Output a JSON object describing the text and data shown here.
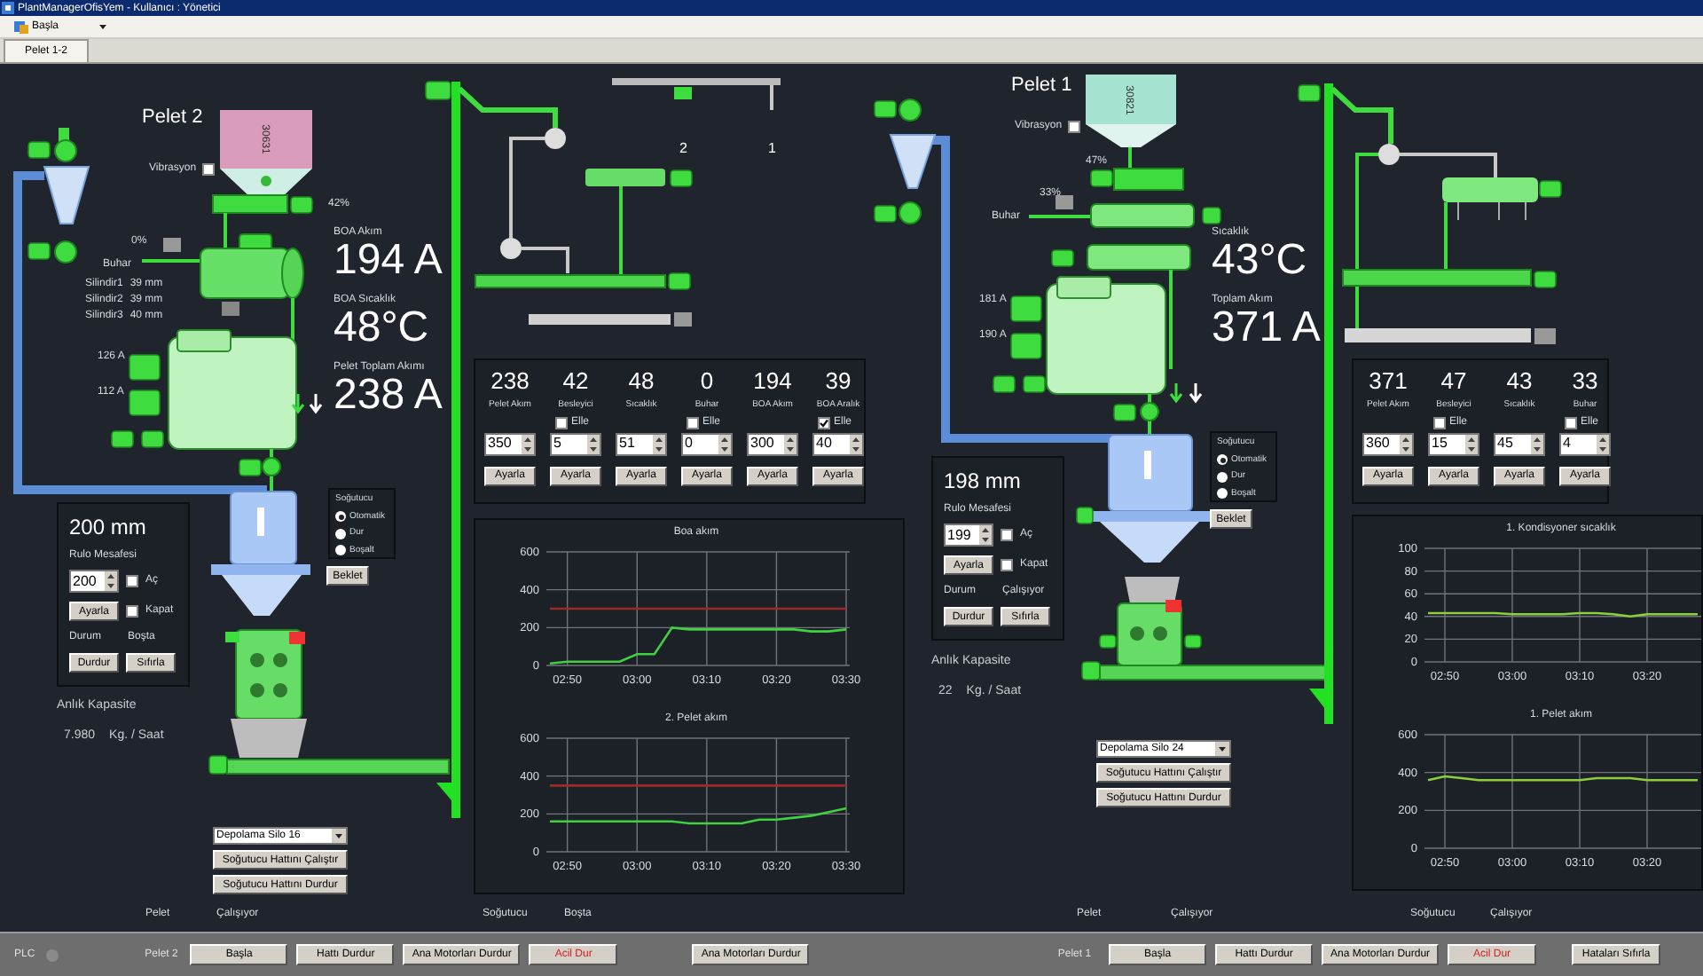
{
  "window": {
    "title": "PlantManagerOfisYem - Kullanıcı : Yönetici"
  },
  "menu": [
    {
      "label": "Başla"
    }
  ],
  "tabs": [
    {
      "label": "Pelet 1-2",
      "selected": true
    }
  ],
  "transfer_gates": [
    "2",
    "1"
  ],
  "lines": [
    {
      "title": "Pelet 2",
      "color": "#d99cbb",
      "silo_code": "30631",
      "vibration": {
        "label": "Vibrasyon",
        "checked": false
      },
      "feeder_percent": "42%",
      "steam": {
        "label": "Buhar",
        "percent": "0%"
      },
      "rollers": [
        {
          "label": "Silindir1",
          "value": "39 mm"
        },
        {
          "label": "Silindir2",
          "value": "39 mm"
        },
        {
          "label": "Silindir3",
          "value": "40 mm"
        }
      ],
      "readings": [
        {
          "label": "BOA Akım",
          "value": "194 A"
        },
        {
          "label": "BOA Sıcaklık",
          "value": "48°C"
        },
        {
          "label": "Pelet Toplam Akımı",
          "value": "238 A"
        }
      ],
      "motor_currents": [
        "126 A",
        "112 A"
      ],
      "setpoints": [
        {
          "value": "238",
          "label": "Pelet Akım",
          "input": "350",
          "button": "Ayarla"
        },
        {
          "value": "42",
          "label": "Besleyici",
          "manual": {
            "label": "Elle",
            "checked": false
          },
          "input": "5",
          "button": "Ayarla"
        },
        {
          "value": "48",
          "label": "Sıcaklık",
          "input": "51",
          "button": "Ayarla"
        },
        {
          "value": "0",
          "label": "Buhar",
          "manual": {
            "label": "Elle",
            "checked": false
          },
          "input": "0",
          "button": "Ayarla"
        },
        {
          "value": "194",
          "label": "BOA Akım",
          "input": "300",
          "button": "Ayarla"
        },
        {
          "value": "39",
          "label": "BOA Aralık",
          "manual": {
            "label": "Elle",
            "checked": true
          },
          "input": "40",
          "button": "Ayarla"
        }
      ],
      "roll_gap": {
        "value": "200 mm",
        "label": "Rulo Mesafesi",
        "input": "200",
        "open": {
          "label": "Aç",
          "checked": false
        },
        "close": {
          "label": "Kapat",
          "checked": false
        },
        "button": "Ayarla",
        "status_label": "Durum",
        "status": "Boşta",
        "buttons": [
          "Durdur",
          "Sıfırla"
        ]
      },
      "capacity": {
        "label": "Anlık Kapasite",
        "value": "7.980",
        "unit": "Kg. / Saat"
      },
      "cooler": {
        "title": "Soğutucu",
        "options": [
          {
            "label": "Otomatik",
            "selected": true
          },
          {
            "label": "Dur",
            "selected": false
          },
          {
            "label": "Boşalt",
            "selected": false
          }
        ],
        "button": "Beklet"
      },
      "silo": {
        "value": "Depolama Silo 16",
        "buttons": [
          "Soğutucu Hattını Çalıştır",
          "Soğutucu Hattını Durdur"
        ]
      },
      "charts": [
        {
          "chart_data": {
            "type": "line",
            "grid": true,
            "title": "Boa akım",
            "categories": [
              null,
              "02:50",
              null,
              null,
              null,
              "03:00",
              null,
              null,
              null,
              "03:10",
              null,
              null,
              null,
              "03:20",
              null,
              null,
              null,
              "03:30"
            ],
            "series": [
              {
                "color": "#3fd13f",
                "values": [
                  10,
                  20,
                  20,
                  20,
                  20,
                  60,
                  60,
                  200,
                  190,
                  190,
                  190,
                  190,
                  190,
                  190,
                  190,
                  180,
                  180,
                  190
                ]
              },
              {
                "color": "#a02828",
                "values": [
                  300,
                  300,
                  300,
                  300,
                  300,
                  300,
                  300,
                  300,
                  300,
                  300,
                  300,
                  300,
                  300,
                  300,
                  300,
                  300,
                  300,
                  300
                ]
              }
            ],
            "ylim": [
              0,
              600
            ],
            "yticks": [
              0,
              200,
              400,
              600
            ]
          }
        },
        {
          "chart_data": {
            "type": "line",
            "grid": true,
            "title": "2. Pelet akım",
            "categories": [
              null,
              "02:50",
              null,
              null,
              null,
              "03:00",
              null,
              null,
              null,
              "03:10",
              null,
              null,
              null,
              "03:20",
              null,
              null,
              null,
              "03:30"
            ],
            "series": [
              {
                "color": "#3fd13f",
                "values": [
                  160,
                  160,
                  160,
                  160,
                  160,
                  160,
                  160,
                  160,
                  150,
                  150,
                  150,
                  150,
                  170,
                  170,
                  180,
                  190,
                  210,
                  230
                ]
              },
              {
                "color": "#a02828",
                "values": [
                  350,
                  350,
                  350,
                  350,
                  350,
                  350,
                  350,
                  350,
                  350,
                  350,
                  350,
                  350,
                  350,
                  350,
                  350,
                  350,
                  350,
                  350
                ]
              }
            ],
            "ylim": [
              0,
              600
            ],
            "yticks": [
              0,
              200,
              400,
              600
            ]
          }
        }
      ],
      "status": [
        {
          "label": "Pelet",
          "value": "Çalışıyor"
        },
        {
          "label": "Soğutucu",
          "value": "Boşta"
        }
      ]
    },
    {
      "title": "Pelet 1",
      "color": "#a6e3d3",
      "silo_code": "30821",
      "vibration": {
        "label": "Vibrasyon",
        "checked": false
      },
      "feeder_percent": "47%",
      "steam": {
        "label": "Buhar",
        "percent": "33%"
      },
      "readings": [
        {
          "label": "Sıcaklık",
          "value": "43°C"
        },
        {
          "label": "Toplam Akım",
          "value": "371 A"
        }
      ],
      "motor_currents": [
        "181 A",
        "190 A"
      ],
      "setpoints": [
        {
          "value": "371",
          "label": "Pelet Akım",
          "input": "360",
          "button": "Ayarla"
        },
        {
          "value": "47",
          "label": "Besleyici",
          "manual": {
            "label": "Elle",
            "checked": false
          },
          "input": "15",
          "button": "Ayarla"
        },
        {
          "value": "43",
          "label": "Sıcaklık",
          "input": "45",
          "button": "Ayarla"
        },
        {
          "value": "33",
          "label": "Buhar",
          "manual": {
            "label": "Elle",
            "checked": false
          },
          "input": "4",
          "button": "Ayarla"
        }
      ],
      "roll_gap": {
        "value": "198 mm",
        "label": "Rulo Mesafesi",
        "input": "199",
        "open": {
          "label": "Aç",
          "checked": false
        },
        "close": {
          "label": "Kapat",
          "checked": false
        },
        "button": "Ayarla",
        "status_label": "Durum",
        "status": "Çalışıyor",
        "buttons": [
          "Durdur",
          "Sıfırla"
        ]
      },
      "capacity": {
        "label": "Anlık Kapasite",
        "value": "22",
        "unit": "Kg. / Saat"
      },
      "cooler": {
        "title": "Soğutucu",
        "options": [
          {
            "label": "Otomatik",
            "selected": true
          },
          {
            "label": "Dur",
            "selected": false
          },
          {
            "label": "Boşalt",
            "selected": false
          }
        ],
        "button": "Beklet"
      },
      "silo": {
        "value": "Depolama Silo 24",
        "buttons": [
          "Soğutucu Hattını Çalıştır",
          "Soğutucu Hattını Durdur"
        ]
      },
      "charts": [
        {
          "chart_data": {
            "type": "line",
            "grid": true,
            "title": "1. Kondisyoner sıcaklık",
            "categories": [
              null,
              "02:50",
              null,
              null,
              null,
              "03:00",
              null,
              null,
              null,
              "03:10",
              null,
              null,
              null,
              "03:20",
              null,
              null,
              null
            ],
            "series": [
              {
                "color": "#8ccf3a",
                "values": [
                  43,
                  43,
                  43,
                  43,
                  43,
                  42,
                  42,
                  42,
                  42,
                  43,
                  43,
                  42,
                  40,
                  42,
                  42,
                  42,
                  42
                ]
              }
            ],
            "ylim": [
              0,
              100
            ],
            "yticks": [
              0,
              20,
              40,
              60,
              80,
              100
            ]
          }
        },
        {
          "chart_data": {
            "type": "line",
            "grid": true,
            "title": "1. Pelet akım",
            "categories": [
              null,
              "02:50",
              null,
              null,
              null,
              "03:00",
              null,
              null,
              null,
              "03:10",
              null,
              null,
              null,
              "03:20",
              null,
              null,
              null
            ],
            "series": [
              {
                "color": "#8ccf3a",
                "values": [
                  360,
                  380,
                  370,
                  360,
                  360,
                  360,
                  360,
                  360,
                  360,
                  360,
                  370,
                  370,
                  370,
                  360,
                  360,
                  360,
                  360
                ]
              }
            ],
            "ylim": [
              0,
              600
            ],
            "yticks": [
              0,
              200,
              400,
              600
            ]
          }
        }
      ],
      "status": [
        {
          "label": "Pelet",
          "value": "Çalışıyor"
        },
        {
          "label": "Soğutucu",
          "value": "Çalışıyor"
        }
      ]
    }
  ],
  "footer": {
    "plc_label": "PLC",
    "plc_on": false,
    "groups": [
      {
        "label": "Pelet 2",
        "buttons": [
          {
            "label": "Başla",
            "kind": "normal"
          },
          {
            "label": "Hattı Durdur",
            "kind": "normal"
          },
          {
            "label": "Ana Motorları Durdur",
            "kind": "normal"
          },
          {
            "label": "Acil Dur",
            "kind": "emergency"
          }
        ]
      },
      {
        "label": "Pelet 1",
        "buttons": [
          {
            "label": "Başla",
            "kind": "normal"
          },
          {
            "label": "Hattı Durdur",
            "kind": "normal"
          },
          {
            "label": "Ana Motorları Durdur",
            "kind": "normal"
          },
          {
            "label": "Acil Dur",
            "kind": "emergency"
          }
        ]
      }
    ],
    "extra_buttons": [
      {
        "label": "Ana Motorları Durdur",
        "kind": "normal"
      },
      {
        "label": "Hataları Sıfırla",
        "kind": "normal"
      }
    ]
  }
}
